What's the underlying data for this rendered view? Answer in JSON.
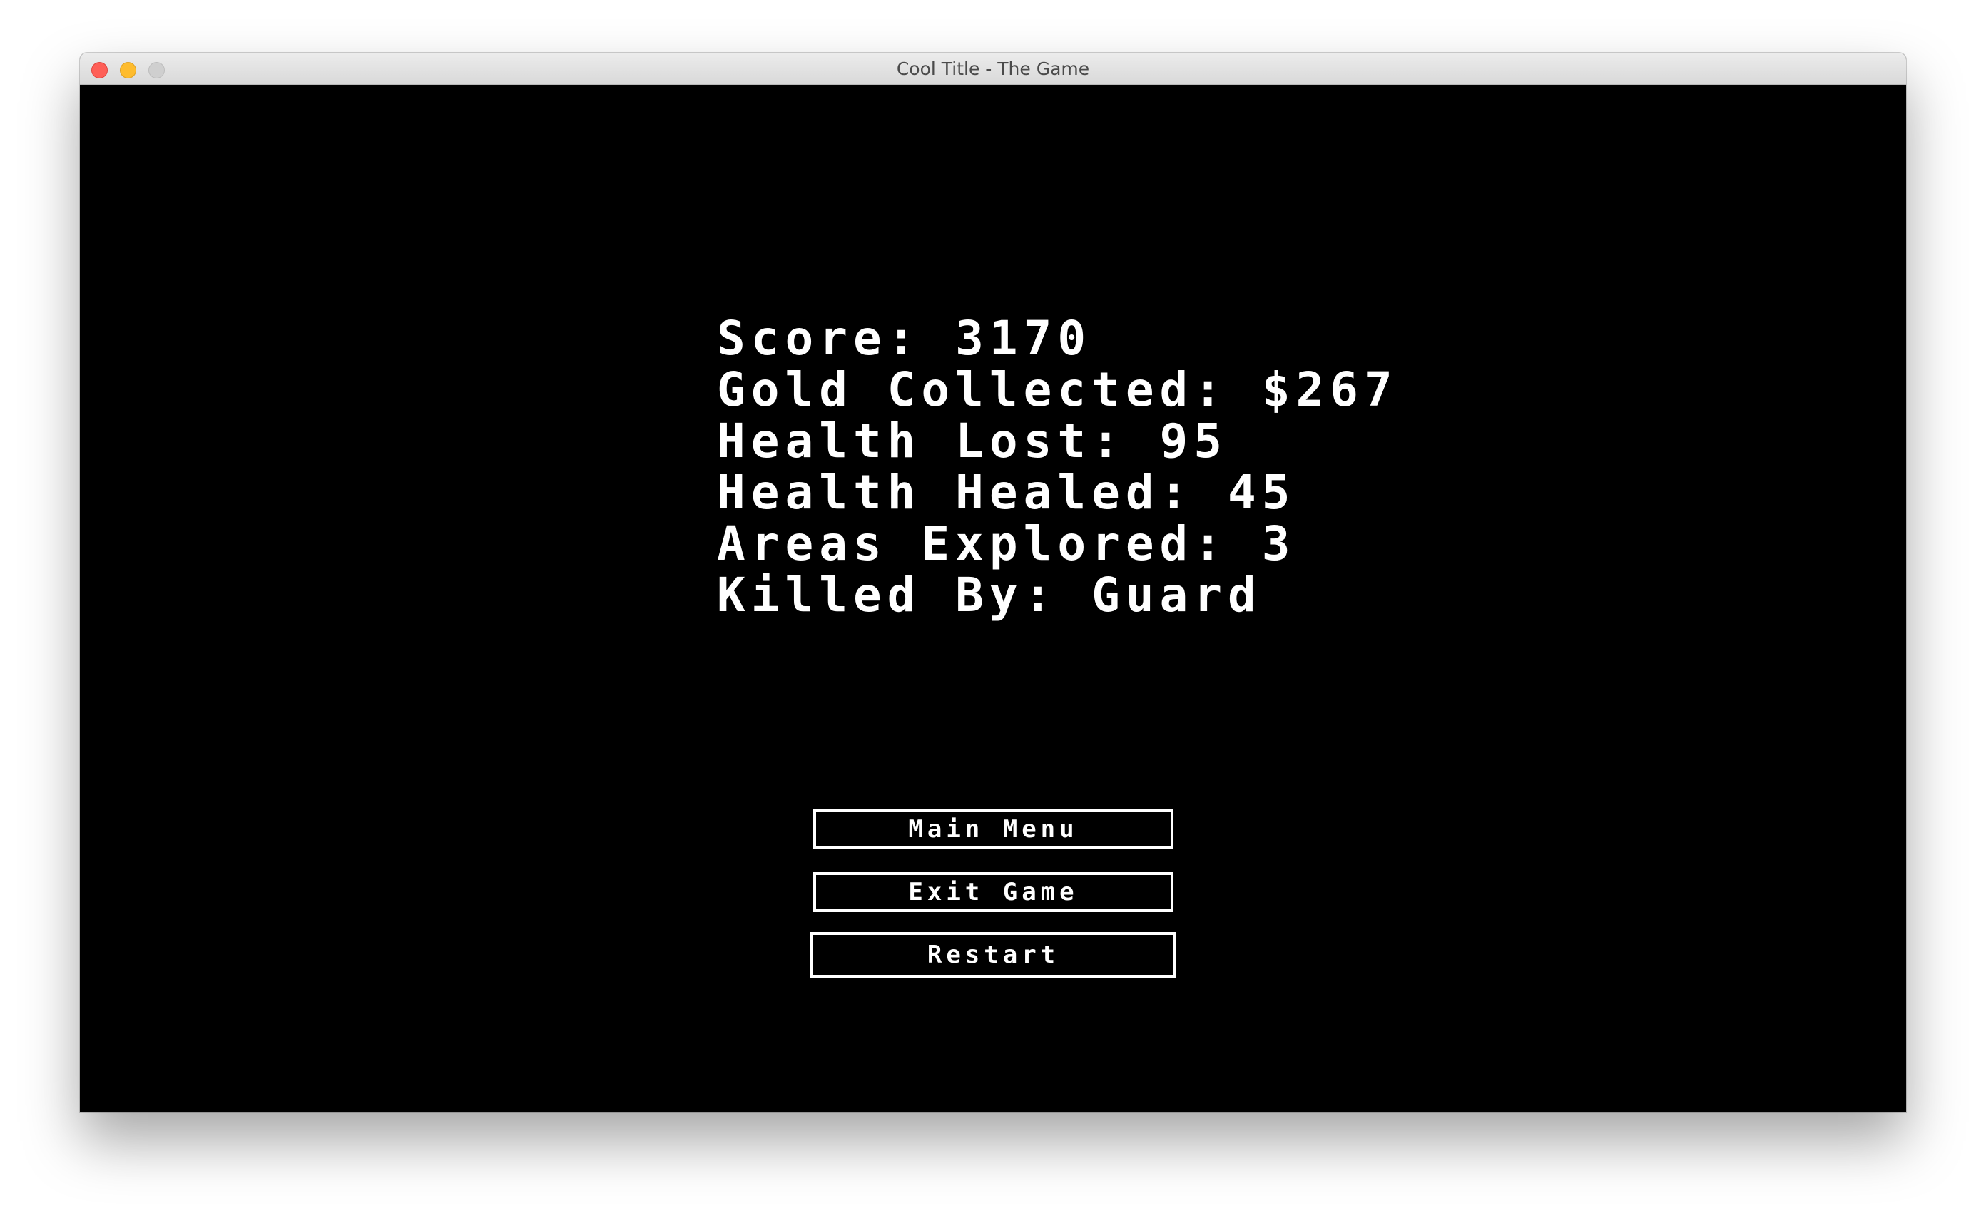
{
  "window": {
    "title": "Cool Title - The Game"
  },
  "stats": [
    {
      "text": "Score: 3170"
    },
    {
      "text": "Gold Collected: $267"
    },
    {
      "text": "Health Lost: 95"
    },
    {
      "text": "Health Healed: 45"
    },
    {
      "text": "Areas Explored: 3"
    },
    {
      "text": "Killed By: Guard"
    }
  ],
  "buttons": {
    "main_menu": "Main Menu",
    "exit_game": "Exit Game",
    "restart": "Restart"
  },
  "colors": {
    "background": "#000000",
    "text": "#ffffff",
    "close": "#fe5f57",
    "minimize": "#febc2e",
    "maximize_disabled": "#cfcfcf"
  }
}
